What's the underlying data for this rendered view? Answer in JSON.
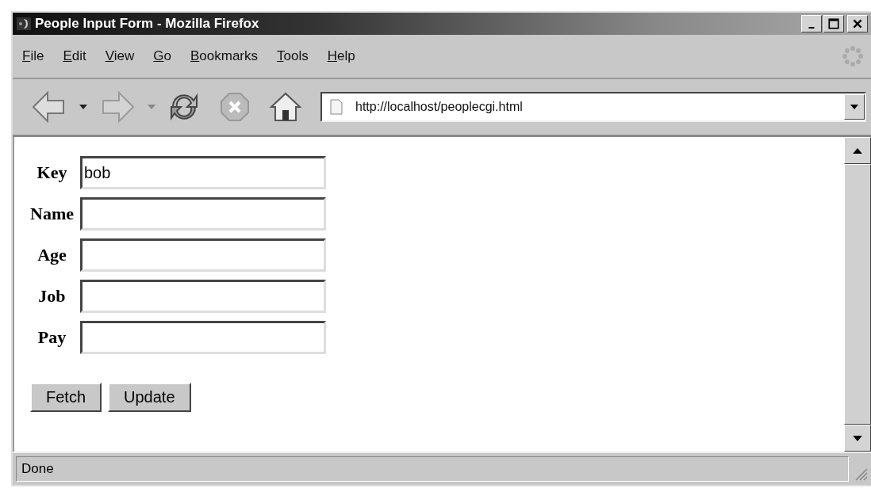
{
  "window": {
    "title": "People Input Form - Mozilla Firefox"
  },
  "menu": [
    {
      "label": "File",
      "mnemonic": true
    },
    {
      "label": "Edit",
      "mnemonic": true
    },
    {
      "label": "View",
      "mnemonic": true
    },
    {
      "label": "Go",
      "mnemonic": true
    },
    {
      "label": "Bookmarks",
      "mnemonic": true
    },
    {
      "label": "Tools",
      "mnemonic": true
    },
    {
      "label": "Help",
      "mnemonic": true
    }
  ],
  "toolbar": {
    "forward_disabled": true,
    "address": "http://localhost/peoplecgi.html"
  },
  "form": {
    "fields": [
      {
        "label": "Key",
        "value": "bob"
      },
      {
        "label": "Name"
      },
      {
        "label": "Age"
      },
      {
        "label": "Job"
      },
      {
        "label": "Pay"
      }
    ],
    "buttons": [
      "Fetch",
      "Update"
    ]
  },
  "status_bar": {
    "text": "Done"
  }
}
